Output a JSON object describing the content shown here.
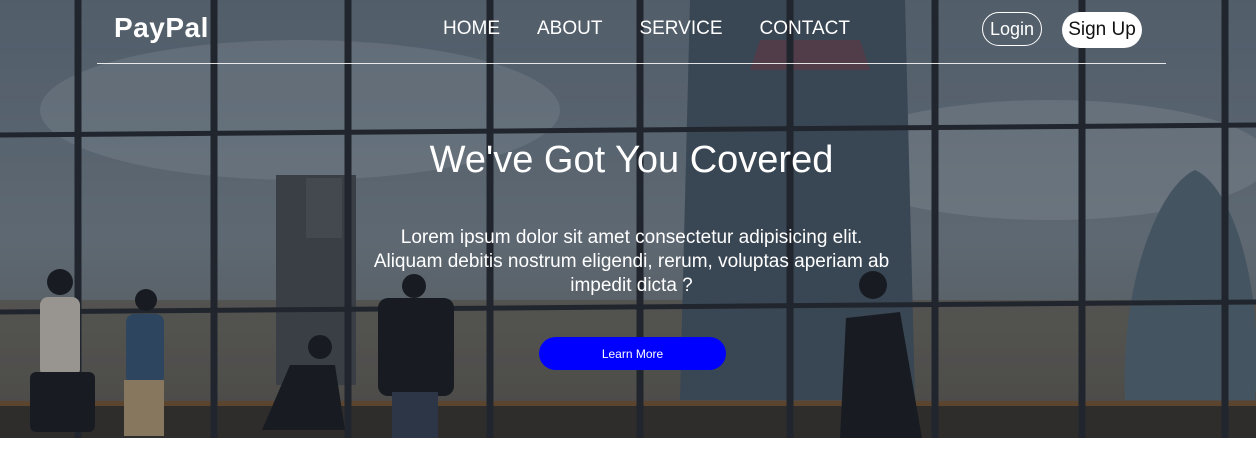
{
  "nav": {
    "logo": "PayPal",
    "links": [
      "HOME",
      "ABOUT",
      "SERVICE",
      "CONTACT"
    ],
    "login_label": "Login",
    "signup_label": "Sign Up"
  },
  "hero": {
    "title": "We've Got You Covered",
    "text": "Lorem ipsum dolor sit amet consectetur adipisicing elit. Aliquam debitis nostrum eligendi, rerum, voluptas aperiam ab impedit dicta ?",
    "cta_label": "Learn More"
  },
  "colors": {
    "accent": "#0000ff",
    "text": "#ffffff",
    "overlay": "rgba(10,15,25,0.28)"
  }
}
